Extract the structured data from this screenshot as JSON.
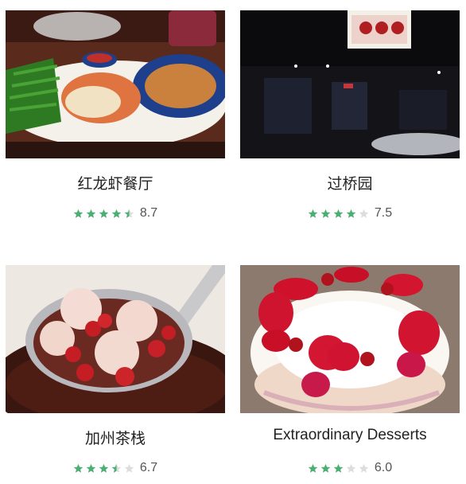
{
  "colors": {
    "star_filled": "#4caf72",
    "star_empty": "#dddddd"
  },
  "restaurants": [
    {
      "name": "红龙虾餐厅",
      "score": "8.7",
      "stars": 4.5,
      "image": "lobster-dish-photo"
    },
    {
      "name": "过桥园",
      "score": "7.5",
      "stars": 4,
      "image": "storefront-night-photo"
    },
    {
      "name": "加州茶栈",
      "score": "6.7",
      "stars": 3.5,
      "image": "dessert-soup-spoon-photo"
    },
    {
      "name": "Extraordinary Desserts",
      "score": "6.0",
      "stars": 3,
      "image": "rose-cake-photo"
    }
  ]
}
